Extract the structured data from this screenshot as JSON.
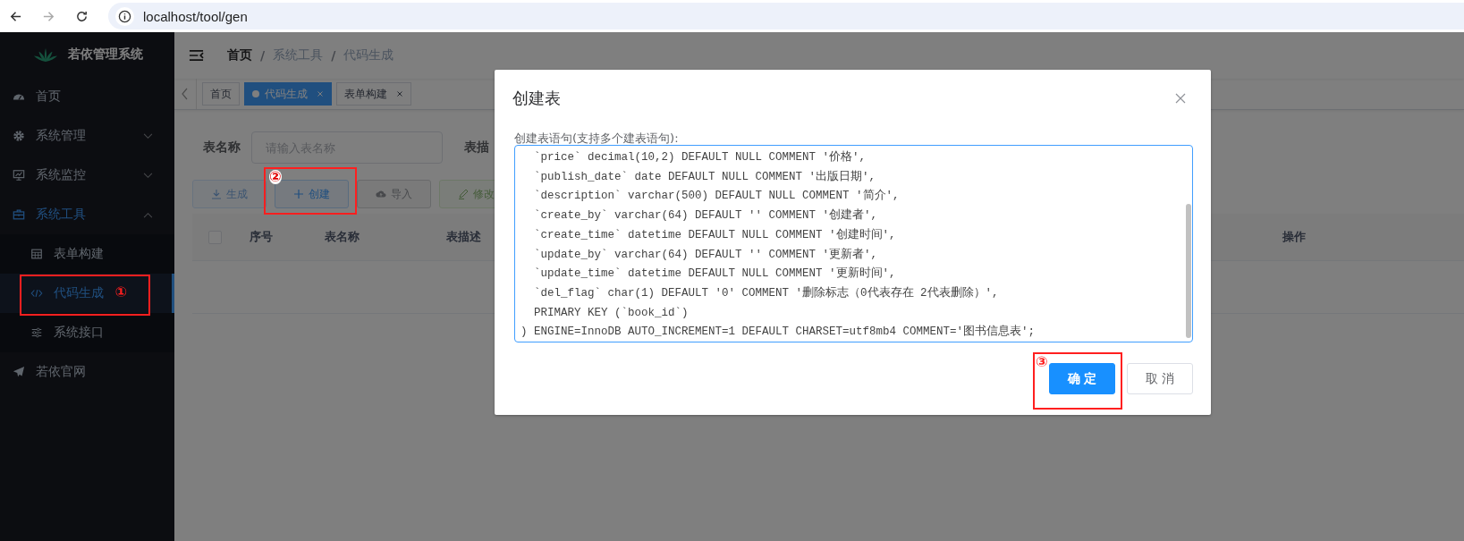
{
  "browser": {
    "address": "localhost/tool/gen"
  },
  "sidebar": {
    "logo": "若依管理系统",
    "items": [
      {
        "label": "首页"
      },
      {
        "label": "系统管理",
        "expanded": false
      },
      {
        "label": "系统监控",
        "expanded": false
      },
      {
        "label": "系统工具",
        "expanded": true,
        "children": [
          {
            "label": "表单构建",
            "selected": false
          },
          {
            "label": "代码生成",
            "selected": true,
            "annotation": "①"
          },
          {
            "label": "系统接口",
            "selected": false
          }
        ]
      },
      {
        "label": "若依官网"
      }
    ]
  },
  "breadcrumb": [
    {
      "label": "首页"
    },
    {
      "separator": "/",
      "label": "系统工具"
    },
    {
      "separator": "/",
      "label": "代码生成"
    }
  ],
  "tags": [
    {
      "label": "首页",
      "selected": false,
      "closable": false
    },
    {
      "label": "代码生成",
      "selected": true,
      "closable": true
    },
    {
      "label": "表单构建",
      "selected": false,
      "closable": true
    }
  ],
  "filters": [
    {
      "label": "表名称",
      "placeholder": "请输入表名称"
    },
    {
      "label": "表描"
    }
  ],
  "toolbar": [
    {
      "label": "生成",
      "kind": "primary",
      "disabled": true
    },
    {
      "label": "创建",
      "kind": "primary",
      "disabled": false,
      "annotation": "②"
    },
    {
      "label": "导入",
      "kind": "info",
      "disabled": false
    },
    {
      "label": "修改",
      "kind": "success",
      "disabled": true
    }
  ],
  "table": {
    "select_all_checked": false,
    "columns": [
      "序号",
      "表名称",
      "表描述",
      "操作"
    ]
  },
  "dialog": {
    "title": "创建表",
    "label": "创建表语句(支持多个建表语句):",
    "sql_lines": [
      "  `price` decimal(10,2) DEFAULT NULL COMMENT '价格',",
      "  `publish_date` date DEFAULT NULL COMMENT '出版日期',",
      "  `description` varchar(500) DEFAULT NULL COMMENT '简介',",
      "  `create_by` varchar(64) DEFAULT '' COMMENT '创建者',",
      "  `create_time` datetime DEFAULT NULL COMMENT '创建时间',",
      "  `update_by` varchar(64) DEFAULT '' COMMENT '更新者',",
      "  `update_time` datetime DEFAULT NULL COMMENT '更新时间',",
      "  `del_flag` char(1) DEFAULT '0' COMMENT '删除标志（0代表存在 2代表删除）',",
      "  PRIMARY KEY (`book_id`)",
      ") ENGINE=InnoDB AUTO_INCREMENT=1 DEFAULT CHARSET=utf8mb4 COMMENT='图书信息表';"
    ],
    "buttons": [
      {
        "label": "确 定",
        "kind": "primary",
        "annotation": "③"
      },
      {
        "label": "取 消",
        "kind": "default"
      }
    ]
  }
}
